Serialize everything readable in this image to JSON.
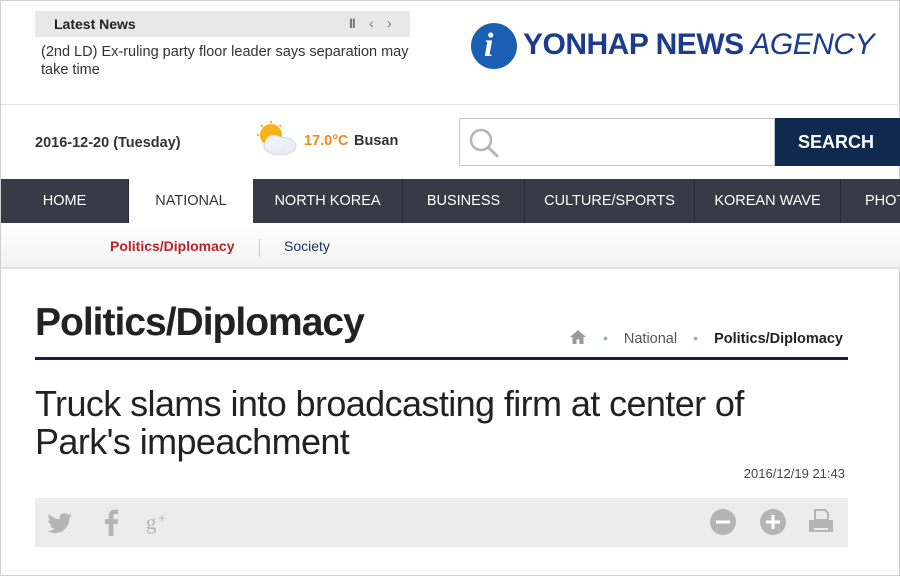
{
  "latest_news": {
    "label": "Latest News",
    "controls": {
      "pause": "II",
      "prev": "‹",
      "next": "›"
    },
    "headline": "(2nd LD) Ex-ruling party floor leader says separation may take time"
  },
  "logo": {
    "icon": "yonhap-logo-icon",
    "bold": "YONHAP NEWS",
    "italic": " AGENCY"
  },
  "info": {
    "date": "2016-12-20 (Tuesday)",
    "weather_icon": "sun-cloud-icon",
    "temperature": "17.0°C",
    "city": "Busan"
  },
  "search": {
    "placeholder": "",
    "value": "",
    "button_label": "SEARCH"
  },
  "nav": {
    "items": [
      {
        "label": "HOME"
      },
      {
        "label": "NATIONAL"
      },
      {
        "label": "NORTH KOREA"
      },
      {
        "label": "BUSINESS"
      },
      {
        "label": "CULTURE/SPORTS"
      },
      {
        "label": "KOREAN WAVE"
      },
      {
        "label": "PHOTO"
      }
    ],
    "active": "NATIONAL"
  },
  "subnav": {
    "items": [
      {
        "label": "Politics/Diplomacy"
      },
      {
        "label": "Society"
      }
    ]
  },
  "section": {
    "title": "Politics/Diplomacy",
    "breadcrumb": {
      "level1": "National",
      "level2": "Politics/Diplomacy"
    }
  },
  "article": {
    "headline": "Truck slams into broadcasting firm at center of Park's impeachment",
    "timestamp": "2016/12/19 21:43"
  },
  "share": {
    "icons": [
      "twitter-icon",
      "facebook-icon",
      "google-plus-icon"
    ]
  },
  "tools": {
    "icons": [
      "zoom-out-icon",
      "zoom-in-icon",
      "print-icon"
    ]
  },
  "colors": {
    "nav_bg": "#3a3a46",
    "search_btn": "#0e2a4f",
    "accent_red": "#b8232a",
    "temp_orange": "#f08c1a",
    "rule_navy": "#16204a"
  }
}
